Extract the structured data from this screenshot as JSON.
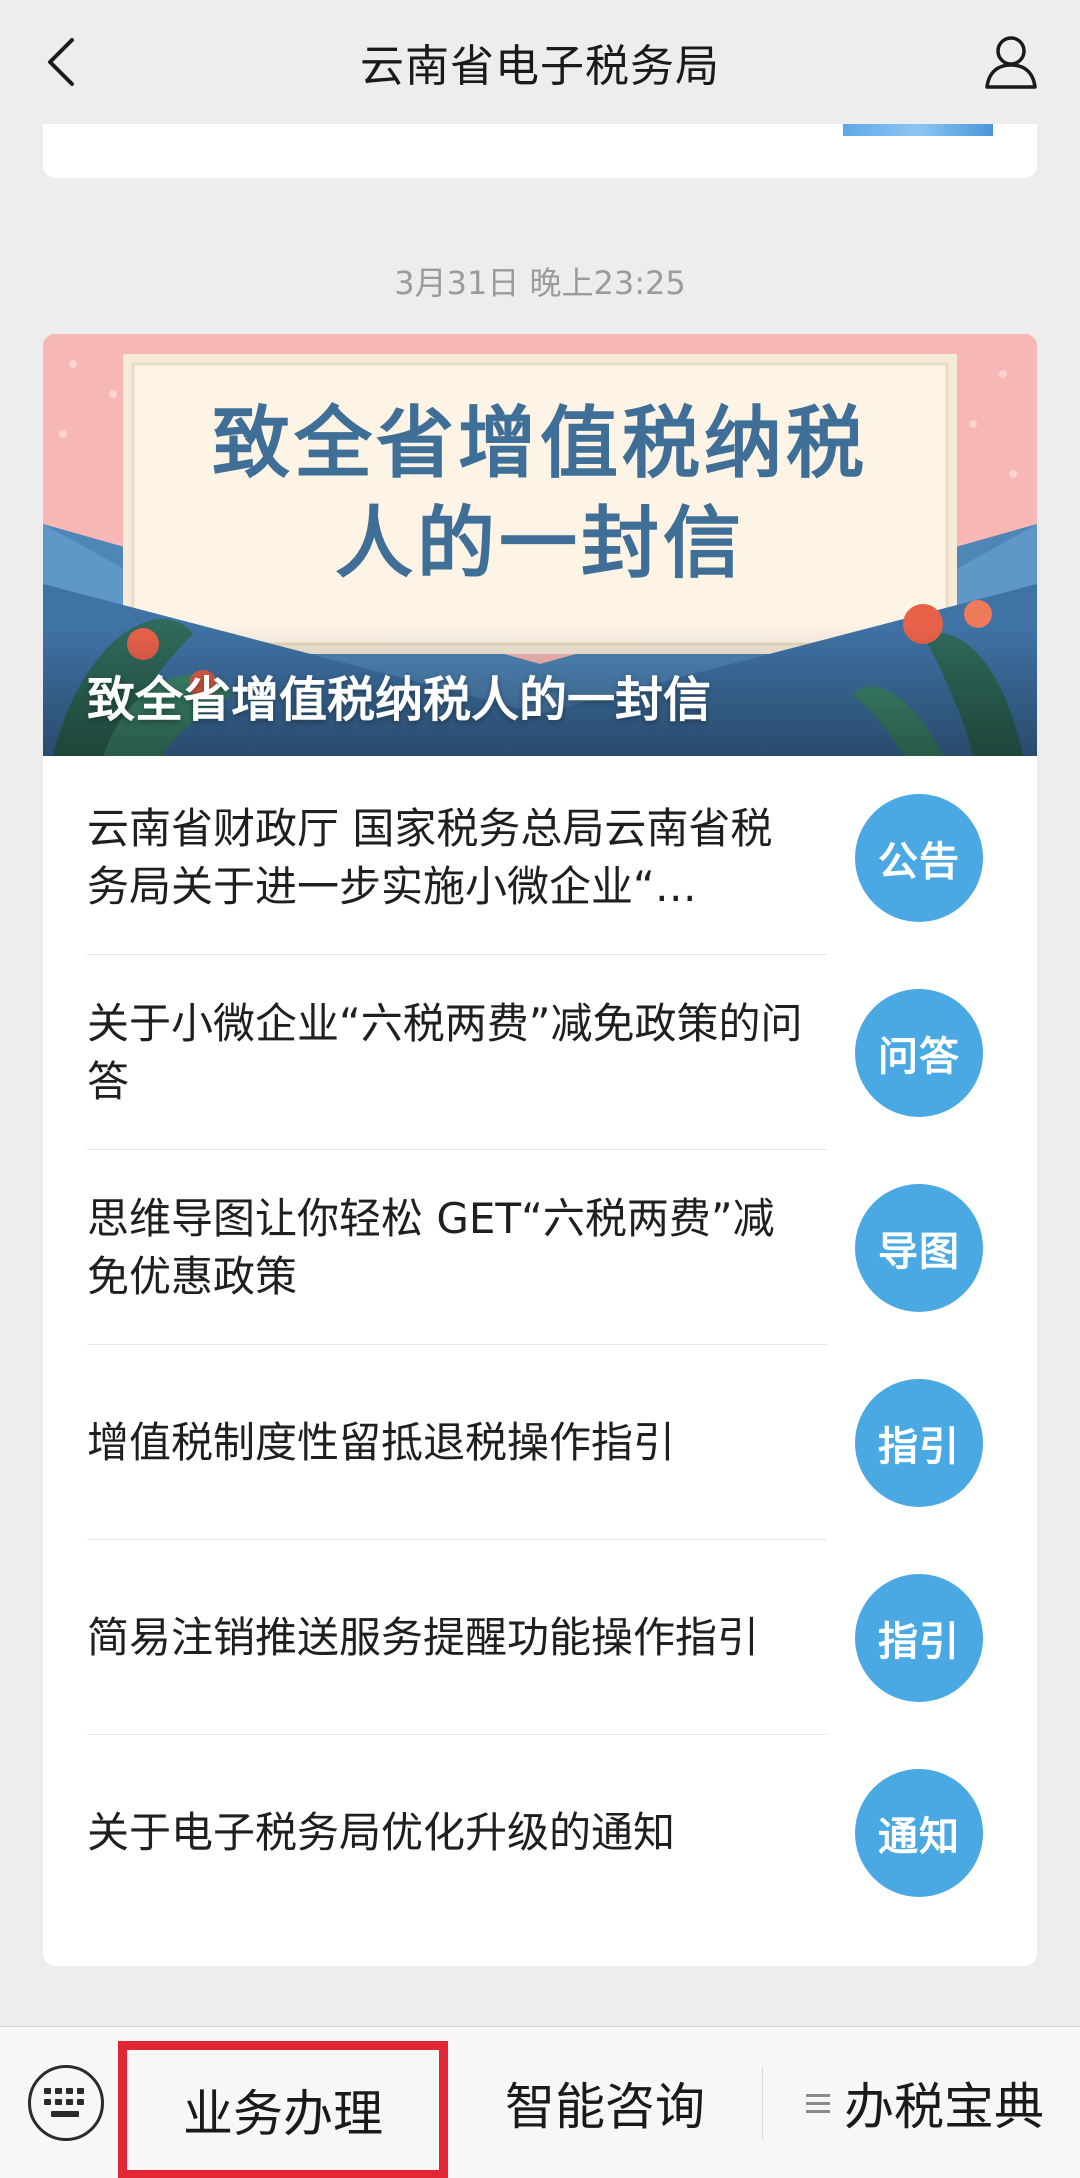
{
  "navbar": {
    "title": "云南省电子税务局"
  },
  "timestamp": "3月31日 晚上23:25",
  "article": {
    "cover_headline_line1": "致全省增值税纳税",
    "cover_headline_line2": "人的一封信",
    "cover_caption": "致全省增值税纳税人的一封信",
    "items": [
      {
        "text": "云南省财政厅 国家税务总局云南省税务局关于进一步实施小微企业“…",
        "badge": "公告"
      },
      {
        "text": "关于小微企业“六税两费”减免政策的问答",
        "badge": "问答"
      },
      {
        "text": "思维导图让你轻松 GET“六税两费”减免优惠政策",
        "badge": "导图"
      },
      {
        "text": "增值税制度性留抵退税操作指引",
        "badge": "指引"
      },
      {
        "text": "简易注销推送服务提醒功能操作指引",
        "badge": "指引"
      },
      {
        "text": "关于电子税务局优化升级的通知",
        "badge": "通知"
      }
    ]
  },
  "bottom_menu": {
    "keyboard_icon": "keyboard-icon",
    "item1": "业务办理",
    "item2": "智能咨询",
    "item3": "办税宝典"
  },
  "colors": {
    "badge": "#4aa8e3",
    "highlight": "#e32636"
  }
}
